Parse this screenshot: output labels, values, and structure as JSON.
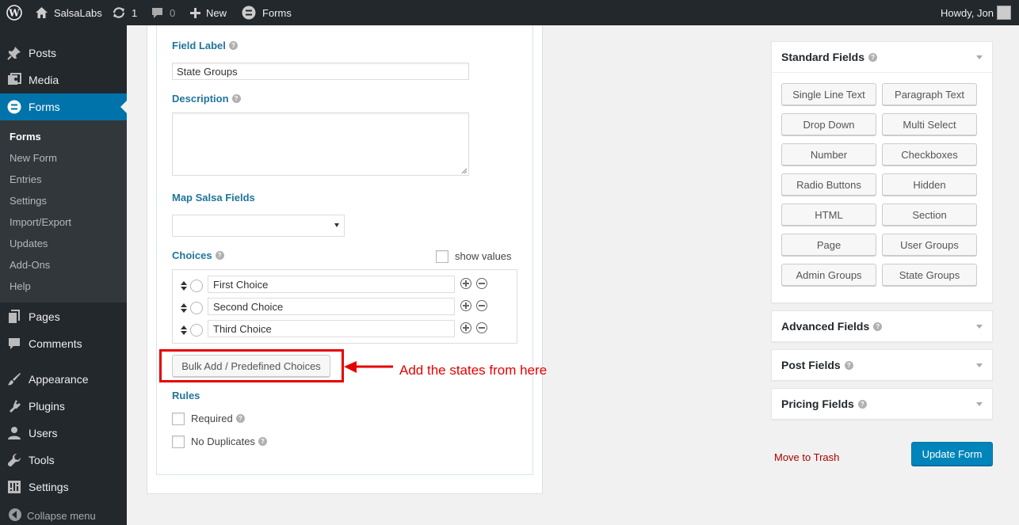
{
  "admin_bar": {
    "site_name": "SalsaLabs",
    "updates_count": "1",
    "comments_count": "0",
    "new_label": "New",
    "forms_label": "Forms",
    "greeting": "Howdy, Jon"
  },
  "sidebar": {
    "items": [
      {
        "label": "Posts",
        "icon": "pushpin-icon"
      },
      {
        "label": "Media",
        "icon": "media-icon"
      },
      {
        "label": "Forms",
        "icon": "forms-icon",
        "active": true
      },
      {
        "label": "Pages",
        "icon": "pages-icon"
      },
      {
        "label": "Comments",
        "icon": "comment-icon"
      },
      {
        "label": "Appearance",
        "icon": "paintbrush-icon"
      },
      {
        "label": "Plugins",
        "icon": "plugin-icon"
      },
      {
        "label": "Users",
        "icon": "user-icon"
      },
      {
        "label": "Tools",
        "icon": "wrench-icon"
      },
      {
        "label": "Settings",
        "icon": "settings-icon"
      }
    ],
    "submenu": [
      "Forms",
      "New Form",
      "Entries",
      "Settings",
      "Import/Export",
      "Updates",
      "Add-Ons",
      "Help"
    ],
    "collapse_label": "Collapse menu"
  },
  "editor": {
    "field_label_heading": "Field Label",
    "field_label_value": "State Groups",
    "description_heading": "Description",
    "map_heading": "Map Salsa Fields",
    "map_value": "",
    "choices_heading": "Choices",
    "show_values_label": "show values",
    "choices": [
      "First Choice",
      "Second Choice",
      "Third Choice"
    ],
    "bulk_button": "Bulk Add / Predefined Choices",
    "rules_heading": "Rules",
    "required_label": "Required",
    "no_duplicates_label": "No Duplicates"
  },
  "annotation": {
    "text": "Add the states from here",
    "color": "#e60000"
  },
  "field_panels": {
    "standard_title": "Standard Fields",
    "standard_buttons": [
      "Single Line Text",
      "Paragraph Text",
      "Drop Down",
      "Multi Select",
      "Number",
      "Checkboxes",
      "Radio Buttons",
      "Hidden",
      "HTML",
      "Section",
      "Page",
      "User Groups",
      "Admin Groups",
      "State Groups"
    ],
    "advanced_title": "Advanced Fields",
    "post_title": "Post Fields",
    "pricing_title": "Pricing Fields"
  },
  "actions": {
    "trash_label": "Move to Trash",
    "update_label": "Update Form"
  },
  "colors": {
    "admin_bar": "#23282d",
    "accent": "#0073aa",
    "label_blue": "#21759b",
    "primary_button": "#0085ba",
    "trash_red": "#a00"
  }
}
